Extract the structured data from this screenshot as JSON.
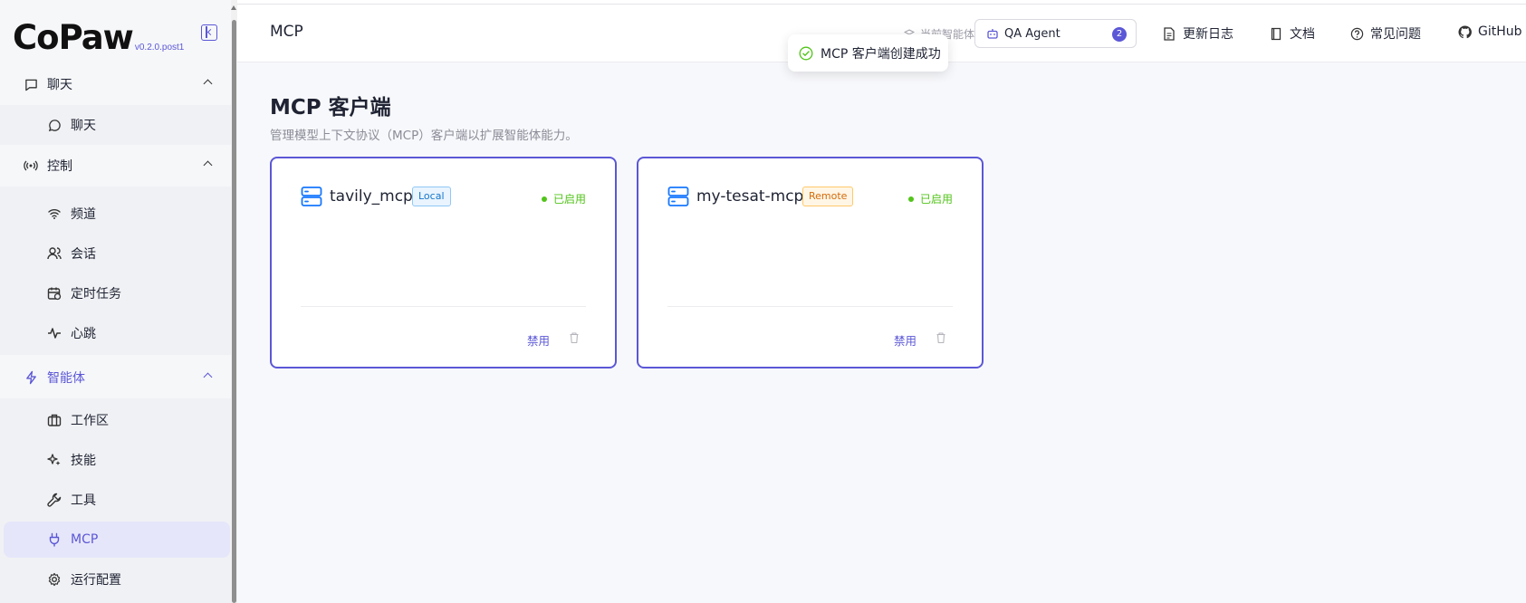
{
  "brand": {
    "name": "CoPaw",
    "version": "v0.2.0.post1"
  },
  "sidebar": {
    "groups": [
      {
        "label": "聊天",
        "icon": "chat-bubble-icon",
        "items": [
          {
            "label": "聊天",
            "icon": "message-circle-icon"
          }
        ]
      },
      {
        "label": "控制",
        "icon": "broadcast-icon",
        "items": [
          {
            "label": "频道",
            "icon": "wifi-icon"
          },
          {
            "label": "会话",
            "icon": "users-icon"
          },
          {
            "label": "定时任务",
            "icon": "calendar-clock-icon"
          },
          {
            "label": "心跳",
            "icon": "heartbeat-icon"
          }
        ]
      },
      {
        "label": "智能体",
        "icon": "lightning-icon",
        "items": [
          {
            "label": "工作区",
            "icon": "briefcase-icon"
          },
          {
            "label": "技能",
            "icon": "sparkles-icon"
          },
          {
            "label": "工具",
            "icon": "wrench-icon"
          },
          {
            "label": "MCP",
            "icon": "plug-icon"
          },
          {
            "label": "运行配置",
            "icon": "gear-icon"
          }
        ]
      }
    ],
    "selected": "MCP"
  },
  "header": {
    "page_tab": "MCP",
    "agent_label": "当前智能体",
    "agent_value": "QA Agent",
    "agent_count": "2",
    "links": [
      "更新日志",
      "文档",
      "常见问题",
      "GitHub"
    ]
  },
  "toast": {
    "message": "MCP 客户端创建成功"
  },
  "main": {
    "title": "MCP 客户端",
    "description": "管理模型上下文协议（MCP）客户端以扩展智能体能力。",
    "cards": [
      {
        "name": "tavily_mcp",
        "tag": "Local",
        "status": "已启用",
        "disable_label": "禁用"
      },
      {
        "name": "my-tesat-mcp",
        "tag": "Remote",
        "status": "已启用",
        "disable_label": "禁用"
      }
    ]
  },
  "colors": {
    "accent": "#5b57d6",
    "enabled": "#52c41a",
    "local_tag": "#1677c9",
    "remote_tag": "#d46b08"
  }
}
